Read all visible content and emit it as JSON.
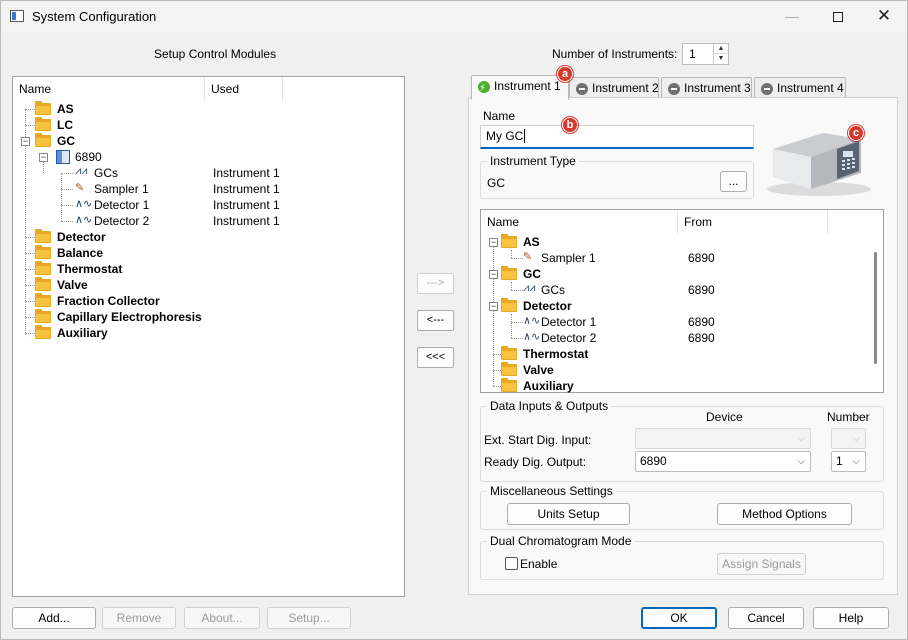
{
  "window": {
    "title": "System Configuration"
  },
  "left": {
    "heading": "Setup Control Modules",
    "columns": [
      "Name",
      "Used"
    ],
    "tree": [
      {
        "label": "AS",
        "bold": true
      },
      {
        "label": "LC",
        "bold": true
      },
      {
        "label": "GC",
        "bold": true
      },
      {
        "label": "6890",
        "bold": false
      },
      {
        "label": "GCs",
        "used": "Instrument 1"
      },
      {
        "label": "Sampler 1",
        "used": "Instrument 1"
      },
      {
        "label": "Detector 1",
        "used": "Instrument 1"
      },
      {
        "label": "Detector 2",
        "used": "Instrument 1"
      },
      {
        "label": "Detector",
        "bold": true
      },
      {
        "label": "Balance",
        "bold": true
      },
      {
        "label": "Thermostat",
        "bold": true
      },
      {
        "label": "Valve",
        "bold": true
      },
      {
        "label": "Fraction Collector",
        "bold": true
      },
      {
        "label": "Capillary Electrophoresis",
        "bold": true
      },
      {
        "label": "Auxiliary",
        "bold": true
      }
    ],
    "buttons": {
      "add": "Add...",
      "remove": "Remove",
      "about": "About...",
      "setup": "Setup..."
    }
  },
  "middle": {
    "add_arrow": "--->",
    "remove_arrow": "<---",
    "remove_all_arrow": "<<<"
  },
  "instruments": {
    "count_label": "Number of Instruments:",
    "count_value": "1",
    "tabs": [
      "Instrument 1",
      "Instrument 2",
      "Instrument 3",
      "Instrument 4"
    ],
    "name_label": "Name",
    "name_value": "My GC",
    "type_group": "Instrument Type",
    "type_value": "GC",
    "type_browse": "...",
    "columns": [
      "Name",
      "From"
    ],
    "tree": [
      {
        "label": "AS",
        "bold": true
      },
      {
        "label": "Sampler 1",
        "from": "6890"
      },
      {
        "label": "GC",
        "bold": true
      },
      {
        "label": "GCs",
        "from": "6890"
      },
      {
        "label": "Detector",
        "bold": true
      },
      {
        "label": "Detector 1",
        "from": "6890"
      },
      {
        "label": "Detector 2",
        "from": "6890"
      },
      {
        "label": "Thermostat",
        "bold": true
      },
      {
        "label": "Valve",
        "bold": true
      },
      {
        "label": "Auxiliary",
        "bold": true
      }
    ],
    "dio": {
      "group": "Data Inputs & Outputs",
      "device_header": "Device",
      "number_header": "Number",
      "ext_start_label": "Ext. Start Dig. Input:",
      "ready_label": "Ready Dig. Output:",
      "ready_device": "6890",
      "ready_number": "1"
    },
    "misc": {
      "group": "Miscellaneous Settings",
      "units": "Units Setup",
      "method": "Method Options"
    },
    "dual": {
      "group": "Dual Chromatogram Mode",
      "enable": "Enable",
      "assign": "Assign Signals"
    }
  },
  "badges": {
    "a": "a",
    "b": "b",
    "c": "c"
  },
  "footer": {
    "ok": "OK",
    "cancel": "Cancel",
    "help": "Help"
  },
  "colors": {
    "accent": "#0067c0",
    "badge": "#d43a2f",
    "folder": "#e8a825"
  }
}
